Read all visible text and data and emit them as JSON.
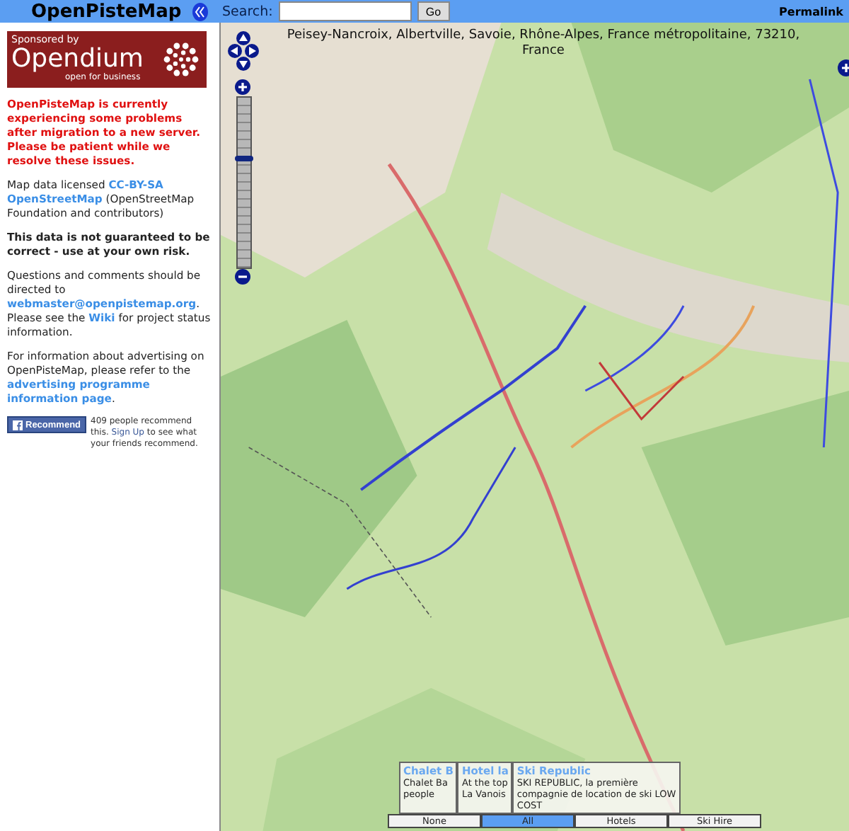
{
  "header": {
    "title": "OpenPisteMap",
    "search_label": "Search:",
    "go_button": "Go",
    "permalink": "Permalink"
  },
  "sidebar": {
    "sponsor": {
      "label": "Sponsored by",
      "name": "Opendium",
      "tagline": "open for business"
    },
    "notice": "OpenPisteMap is currently experiencing some problems after migration to a new server. Please be patient while we resolve these issues.",
    "paragraphs": [
      {
        "kind": "plain",
        "parts": [
          {
            "kind": "text",
            "text": "Map data licensed "
          },
          {
            "kind": "link",
            "text": "CC-BY-SA"
          },
          {
            "kind": "link",
            "text": "OpenStreetMap"
          },
          {
            "kind": "text",
            "text": " (OpenStreetMap Foundation and contributors)"
          }
        ]
      },
      {
        "kind": "bold",
        "parts": [
          {
            "kind": "text",
            "text": "This data is not guaranteed to be correct - use at your own risk."
          }
        ]
      },
      {
        "kind": "plain",
        "parts": [
          {
            "kind": "text",
            "text": "Questions and comments should be directed to "
          },
          {
            "kind": "link",
            "text": "webmaster@openpistemap.org"
          },
          {
            "kind": "text",
            "text": ". Please see the "
          },
          {
            "kind": "link",
            "text": "Wiki"
          },
          {
            "kind": "text",
            "text": " for project status information."
          }
        ]
      },
      {
        "kind": "plain",
        "parts": [
          {
            "kind": "text",
            "text": "For information about advertising on OpenPisteMap, please refer to the "
          },
          {
            "kind": "link",
            "text": "advertising programme"
          },
          {
            "kind": "link",
            "text": "information page"
          },
          {
            "kind": "text",
            "text": "."
          }
        ]
      }
    ],
    "facebook": {
      "button": "Recommend",
      "count_text": "409 people recommend this.",
      "signup_link": "Sign Up",
      "signup_text": "to see what your friends recommend."
    }
  },
  "map": {
    "address": "Peisey-Nancroix, Albertville, Savoie, Rhône-Alpes, France métropolitaine, 73210, France",
    "zoom": {
      "level": 0.65
    },
    "popups": [
      {
        "title": "Chalet B",
        "lines": [
          "Chalet Ba",
          "people"
        ]
      },
      {
        "title": "Hotel la",
        "lines": [
          "At the top",
          "La Vanois"
        ]
      },
      {
        "title": "Ski Republic",
        "lines": [
          "SKI REPUBLIC, la première",
          "compagnie de location de ski LOW",
          "COST"
        ]
      }
    ],
    "tabs": [
      {
        "label": "None",
        "selected": false
      },
      {
        "label": "All",
        "selected": true
      },
      {
        "label": "Hotels",
        "selected": false
      },
      {
        "label": "Ski Hire",
        "selected": false
      }
    ]
  }
}
